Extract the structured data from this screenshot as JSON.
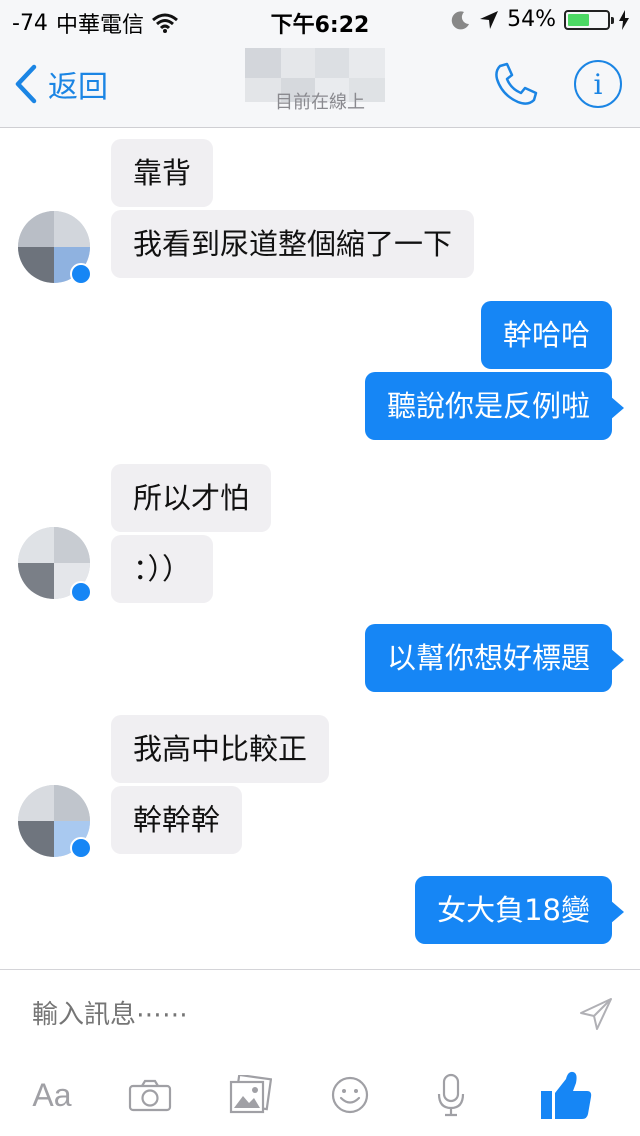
{
  "status_bar": {
    "signal": "-74",
    "carrier": "中華電信",
    "time": "下午6:22",
    "battery": "54%",
    "battery_level": 0.54
  },
  "nav": {
    "back_label": "返回",
    "subtitle": "目前在線上"
  },
  "messages": [
    {
      "side": "in",
      "text": "靠背"
    },
    {
      "side": "in",
      "text": "我看到尿道整個縮了一下"
    },
    {
      "side": "out",
      "text": "幹哈哈"
    },
    {
      "side": "out",
      "text": "聽說你是反例啦"
    },
    {
      "side": "in",
      "text": "所以才怕"
    },
    {
      "side": "in",
      "text": "：））"
    },
    {
      "side": "out",
      "text": "以幫你想好標題"
    },
    {
      "side": "in",
      "text": "我高中比較正"
    },
    {
      "side": "in",
      "text": "幹幹幹"
    },
    {
      "side": "out",
      "text": "女大負18變"
    }
  ],
  "composer": {
    "placeholder": "輸入訊息⋯⋯",
    "text_format_label": "Aa"
  },
  "colors": {
    "accent": "#1b85e4",
    "outgoing_bubble": "#1686f5",
    "incoming_bubble": "#f0eff2",
    "battery": "#4cd964"
  },
  "icons": [
    "wifi-icon",
    "moon-icon",
    "location-arrow-icon",
    "charging-icon",
    "back-chevron-icon",
    "phone-icon",
    "info-icon",
    "send-icon",
    "camera-icon",
    "gallery-icon",
    "emoji-icon",
    "microphone-icon",
    "like-icon"
  ]
}
